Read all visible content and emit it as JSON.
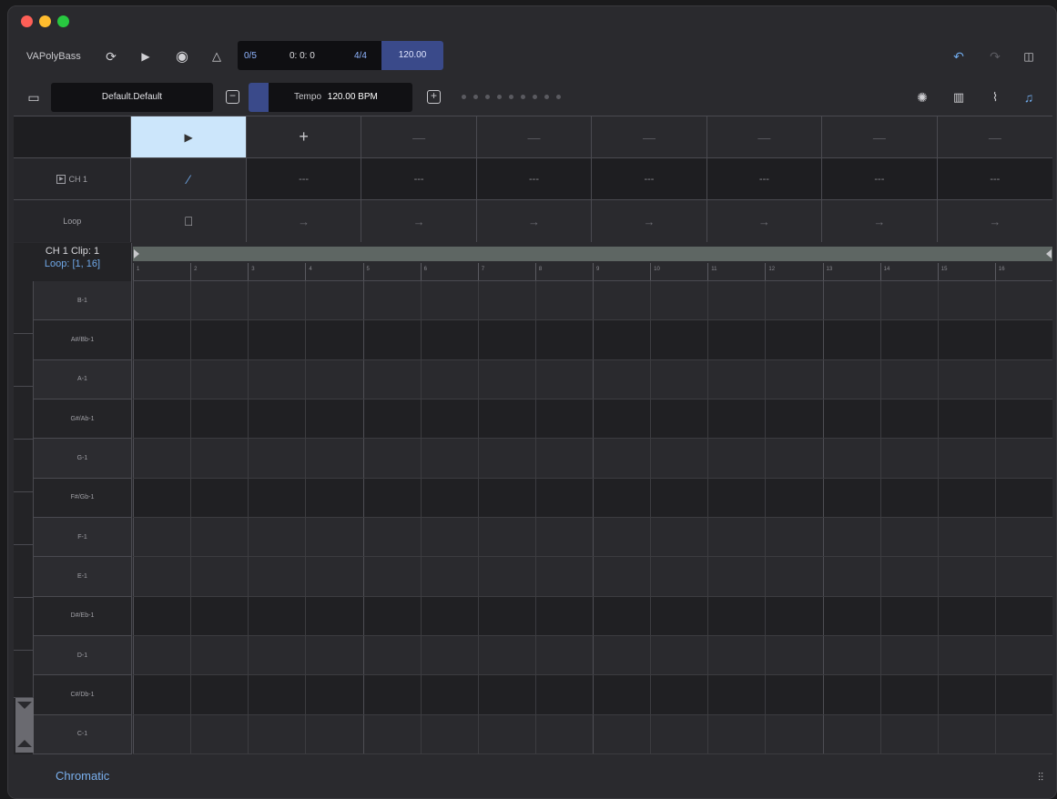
{
  "app": {
    "name": "VAPolyBass"
  },
  "transport": {
    "bar": "0/5",
    "time": "0: 0: 0",
    "signature": "4/4",
    "tempo": "120.00"
  },
  "preset": {
    "name": "Default.Default"
  },
  "tempo_control": {
    "label": "Tempo",
    "value": "120.00 BPM"
  },
  "clips": {
    "channel_label": "CH 1",
    "loop_label": "Loop",
    "play_symbol": "▶",
    "add_symbol": "+",
    "empty_symbol": "—",
    "edit_symbol": "⁄",
    "dashes": "---",
    "arrow": "→"
  },
  "piano_roll": {
    "clip_title": "CH 1 Clip: 1",
    "loop_range": "Loop: [1, 16]",
    "ruler": [
      "1",
      "2",
      "3",
      "4",
      "5",
      "6",
      "7",
      "8",
      "9",
      "10",
      "11",
      "12",
      "13",
      "14",
      "15",
      "16"
    ],
    "notes": [
      "B-1",
      "A#/Bb-1",
      "A-1",
      "G#/Ab-1",
      "G-1",
      "F#/Gb-1",
      "F-1",
      "E-1",
      "D#/Eb-1",
      "D-1",
      "C#/Db-1",
      "C-1"
    ]
  },
  "footer": {
    "scale": "Chromatic"
  },
  "colors": {
    "accent": "#3a4a8a",
    "link": "#7ab0ee",
    "playing_clip": "#cce6fb"
  }
}
